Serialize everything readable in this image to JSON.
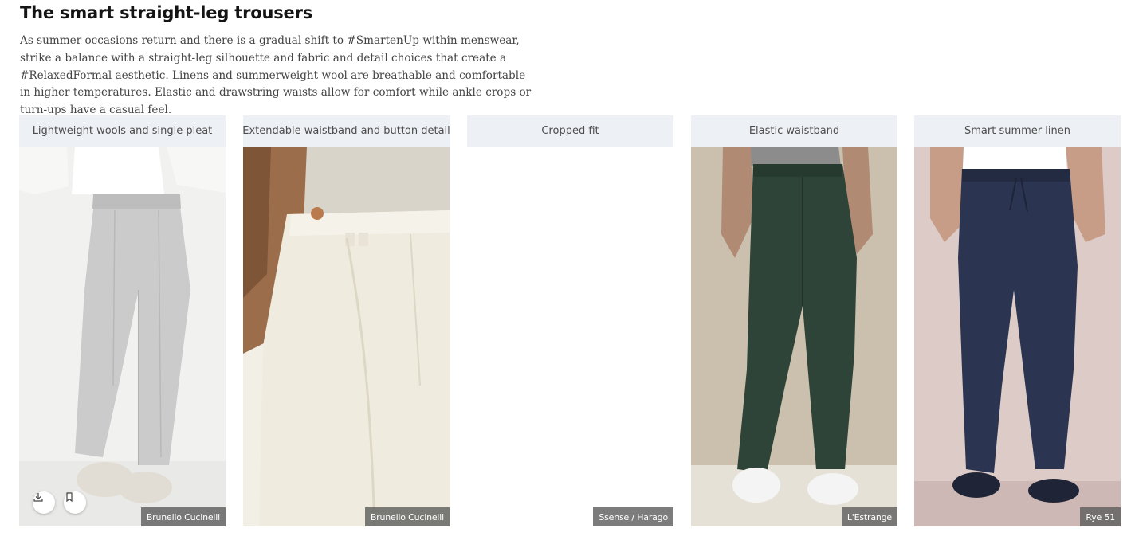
{
  "section": {
    "title": "The smart straight-leg trousers",
    "intro": {
      "p1": "As summer occasions return and there is a gradual shift to ",
      "tag1": "#SmartenUp",
      "p2": " within menswear, strike a balance with a straight-leg silhouette and fabric and detail choices that create a ",
      "tag2": "#RelaxedFormal",
      "p3": " aesthetic. Linens and summerweight wool are breathable and comfortable in higher temperatures. Elastic and drawstring waists allow for comfort while ankle crops or turn-ups have a casual feel."
    }
  },
  "cards": [
    {
      "header": "Lightweight wools and single pleat",
      "credit": "Brunello Cucinelli"
    },
    {
      "header": "Extendable waistband and button detail",
      "credit": "Brunello Cucinelli"
    },
    {
      "header": "Cropped fit",
      "credit": "Ssense / Harago"
    },
    {
      "header": "Elastic waistband",
      "credit": "L'Estrange"
    },
    {
      "header": "Smart summer linen",
      "credit": "Rye 51"
    }
  ],
  "actions": {
    "download_icon": "download-icon",
    "bookmark_icon": "bookmark-icon"
  },
  "colors": {
    "header_bg": "#edf0f4",
    "trouser_grey": "#c9c9c9",
    "trouser_cream": "#efeadb",
    "trouser_green": "#2e4438",
    "trouser_navy": "#2b3450"
  }
}
